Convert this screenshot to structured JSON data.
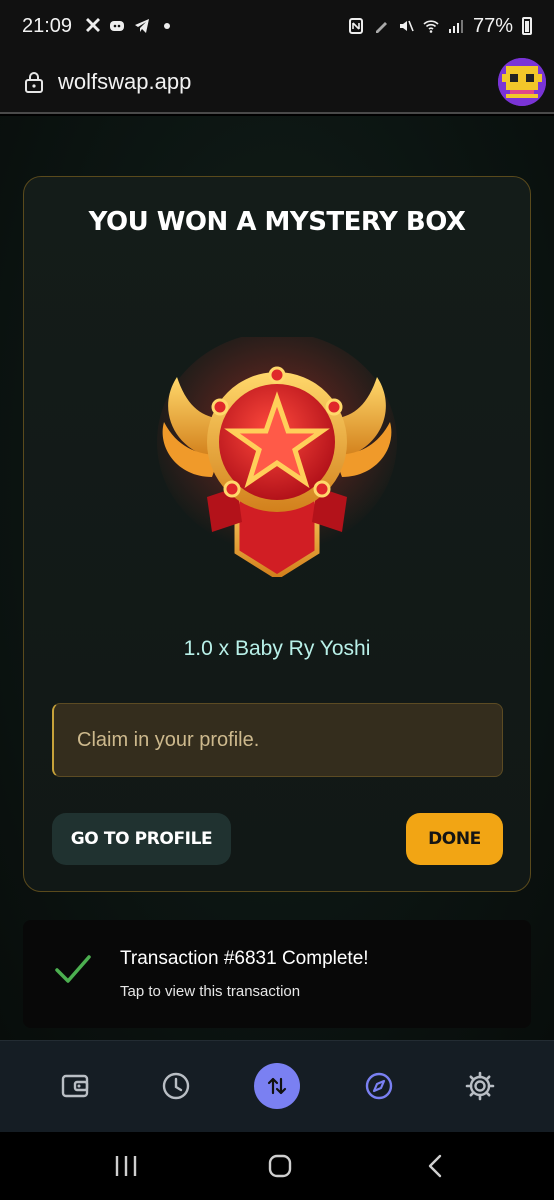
{
  "status_bar": {
    "time": "21:09",
    "battery": "77%"
  },
  "browser": {
    "url": "wolfswap.app"
  },
  "modal": {
    "title": "YOU WON A MYSTERY BOX",
    "prize_text": "1.0 x Baby Ry Yoshi",
    "claim_message": "Claim in your profile.",
    "go_to_profile_label": "GO TO PROFILE",
    "done_label": "DONE"
  },
  "toast": {
    "title": "Transaction #6831 Complete!",
    "subtitle": "Tap to view this transaction"
  },
  "app_nav": {
    "items": [
      "wallet-icon",
      "history-icon",
      "swap-icon",
      "compass-icon",
      "settings-icon"
    ],
    "active_color": "#7a80f2",
    "accent": "#f2a514"
  }
}
